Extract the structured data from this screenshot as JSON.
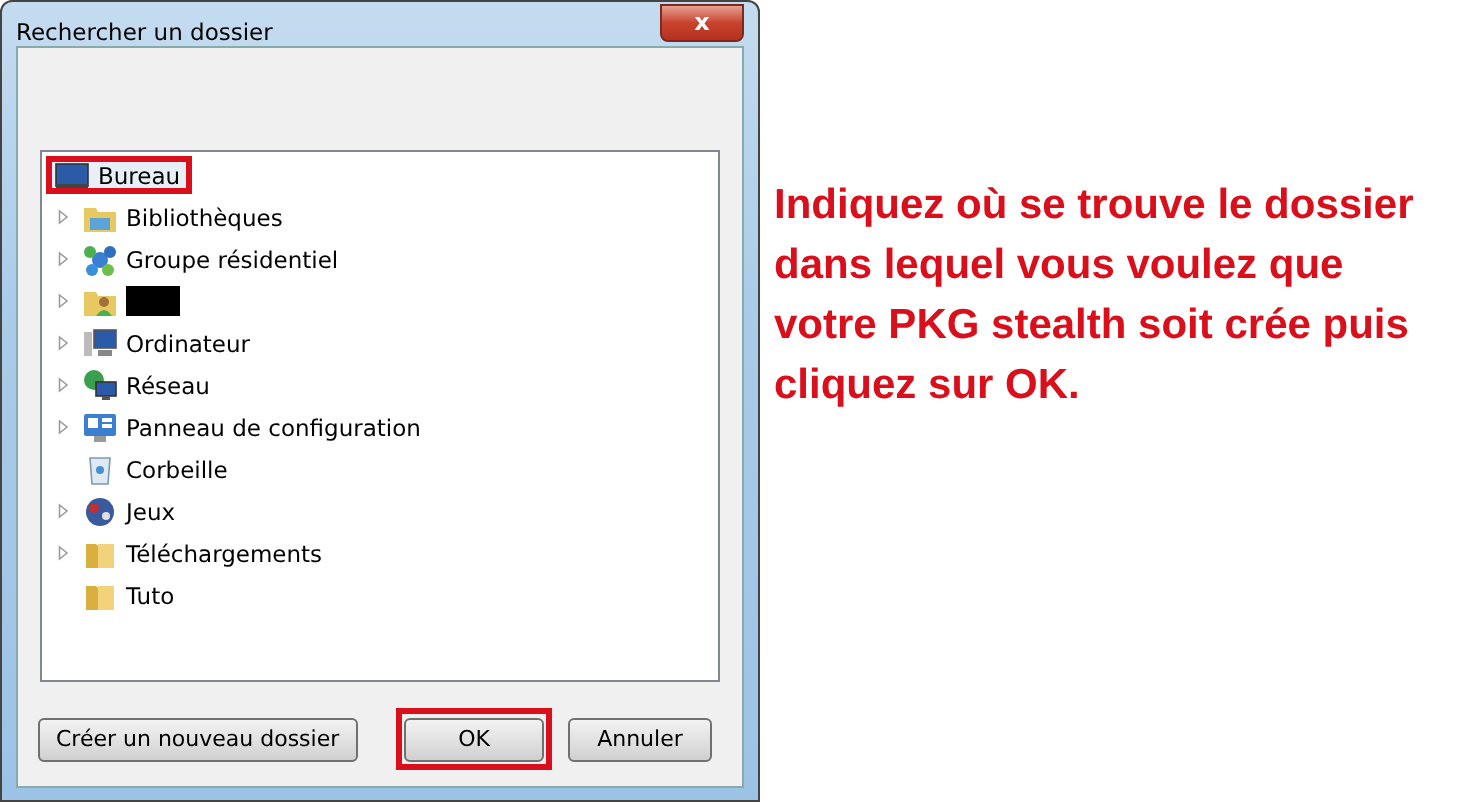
{
  "window": {
    "title": "Rechercher un dossier",
    "close_label": "x"
  },
  "tree": {
    "root": {
      "label": "Bureau",
      "kind": "desktop",
      "selected": true,
      "annotated": true,
      "children": [
        {
          "label": "Bibliothèques",
          "kind": "libraries",
          "expandable": true
        },
        {
          "label": "Groupe résidentiel",
          "kind": "homegroup",
          "expandable": true
        },
        {
          "kind": "user",
          "expandable": true,
          "redacted": true
        },
        {
          "label": "Ordinateur",
          "kind": "computer",
          "expandable": true
        },
        {
          "label": "Réseau",
          "kind": "network",
          "expandable": true
        },
        {
          "label": "Panneau de configuration",
          "kind": "control-panel",
          "expandable": true
        },
        {
          "label": "Corbeille",
          "kind": "recycle-bin",
          "expandable": false
        },
        {
          "label": "Jeux",
          "kind": "games",
          "expandable": true
        },
        {
          "label": "Téléchargements",
          "kind": "folder",
          "expandable": true
        },
        {
          "label": "Tuto",
          "kind": "folder",
          "expandable": false
        }
      ]
    }
  },
  "buttons": [
    {
      "label": "Créer un nouveau dossier",
      "kind": "new-folder",
      "annotated": false
    },
    {
      "label": "OK",
      "kind": "ok",
      "annotated": true
    },
    {
      "label": "Annuler",
      "kind": "cancel",
      "annotated": false
    }
  ],
  "instruction": "Indiquez où se trouve le dossier dans lequel vous voulez que votre PKG stealth soit crée puis cliquez sur OK."
}
